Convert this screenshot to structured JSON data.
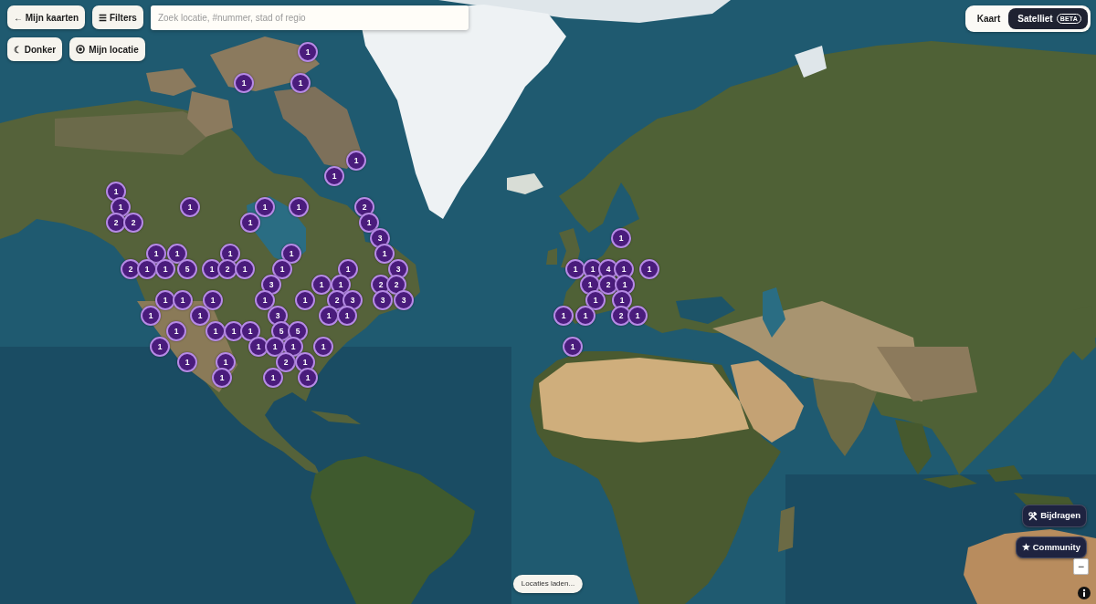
{
  "toolbar": {
    "buttons": [
      {
        "label": "← Mijn kaarten"
      },
      {
        "label": "☰ Filters"
      }
    ],
    "search": {
      "placeholder": "Zoek locatie, #nummer, stad of regio"
    }
  },
  "view_buttons": [
    {
      "kind": "plain",
      "label": "☾ Donker"
    },
    {
      "kind": "locate",
      "label": "Mijn locatie"
    }
  ],
  "map_type": [
    {
      "label": "Kaart",
      "selected": false
    },
    {
      "label": "Satelliet",
      "selected": true,
      "badge": "BETA"
    }
  ],
  "markers": [
    {
      "count": "1"
    },
    {
      "count": "1"
    },
    {
      "count": "1"
    },
    {
      "count": "1"
    },
    {
      "count": "1"
    },
    {
      "count": "1"
    },
    {
      "count": "1"
    },
    {
      "count": "1"
    },
    {
      "count": "1"
    },
    {
      "count": "1"
    },
    {
      "count": "2"
    },
    {
      "count": "2"
    },
    {
      "count": "2"
    },
    {
      "count": "1"
    },
    {
      "count": "1"
    },
    {
      "count": "3"
    },
    {
      "count": "1"
    },
    {
      "count": "1"
    },
    {
      "count": "1"
    },
    {
      "count": "1"
    },
    {
      "count": "1"
    },
    {
      "count": "1"
    },
    {
      "count": "2"
    },
    {
      "count": "1"
    },
    {
      "count": "1"
    },
    {
      "count": "5"
    },
    {
      "count": "1"
    },
    {
      "count": "2"
    },
    {
      "count": "1"
    },
    {
      "count": "1"
    },
    {
      "count": "1"
    },
    {
      "count": "3"
    },
    {
      "count": "1"
    },
    {
      "count": "1"
    },
    {
      "count": "4"
    },
    {
      "count": "1"
    },
    {
      "count": "1"
    },
    {
      "count": "3"
    },
    {
      "count": "1"
    },
    {
      "count": "1"
    },
    {
      "count": "2"
    },
    {
      "count": "2"
    },
    {
      "count": "1"
    },
    {
      "count": "2"
    },
    {
      "count": "1"
    },
    {
      "count": "1"
    },
    {
      "count": "1"
    },
    {
      "count": "1"
    },
    {
      "count": "1"
    },
    {
      "count": "1"
    },
    {
      "count": "2"
    },
    {
      "count": "3"
    },
    {
      "count": "3"
    },
    {
      "count": "3"
    },
    {
      "count": "1"
    },
    {
      "count": "1"
    },
    {
      "count": "1"
    },
    {
      "count": "1"
    },
    {
      "count": "3"
    },
    {
      "count": "1"
    },
    {
      "count": "1"
    },
    {
      "count": "1"
    },
    {
      "count": "1"
    },
    {
      "count": "2"
    },
    {
      "count": "1"
    },
    {
      "count": "1"
    },
    {
      "count": "1"
    },
    {
      "count": "1"
    },
    {
      "count": "1"
    },
    {
      "count": "5"
    },
    {
      "count": "5"
    },
    {
      "count": "1"
    },
    {
      "count": "1"
    },
    {
      "count": "1"
    },
    {
      "count": "1"
    },
    {
      "count": "1"
    },
    {
      "count": "1"
    },
    {
      "count": "1"
    },
    {
      "count": "1"
    },
    {
      "count": "2"
    },
    {
      "count": "1"
    },
    {
      "count": "1"
    },
    {
      "count": "1"
    },
    {
      "count": "1"
    }
  ],
  "actions": [
    {
      "kind": "tools",
      "label": "Bijdragen"
    },
    {
      "kind": "plain",
      "label": "★ Community"
    }
  ],
  "zoom_out": "−",
  "status": "Locaties laden..."
}
